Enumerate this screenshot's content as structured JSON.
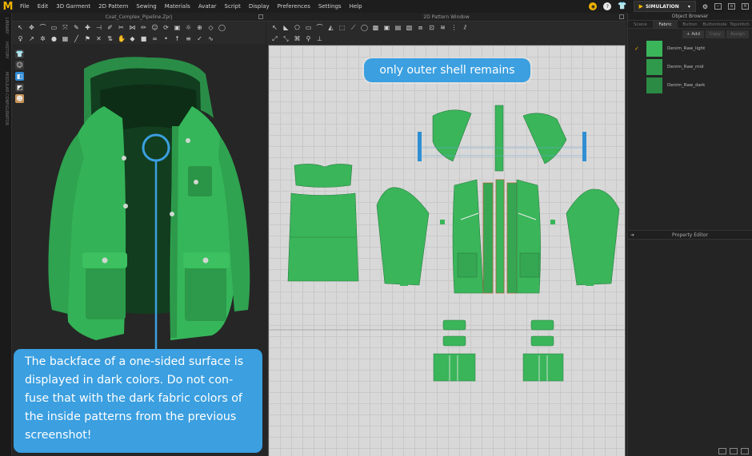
{
  "app": {
    "logo": "M",
    "menu": [
      "File",
      "Edit",
      "3D Garment",
      "2D Pattern",
      "Sewing",
      "Materials",
      "Avatar",
      "Script",
      "Display",
      "Preferences",
      "Settings",
      "Help"
    ],
    "simulation_label": "SIMULATION"
  },
  "left_strip": {
    "labels": [
      "LIBRARY",
      "HISTORY",
      "MODULAR CONFIGURATOR"
    ]
  },
  "window_3d": {
    "title": "Coat_Complex_Pipeline.Zprj"
  },
  "window_2d": {
    "title": "2D Pattern Window"
  },
  "object_browser": {
    "title": "Object Browser",
    "tabs": [
      "Scene",
      "Fabric",
      "Button",
      "Buttonhole",
      "Topstitch"
    ],
    "active_tab": "Fabric",
    "actions": [
      "+ Add",
      "Copy",
      "Assign"
    ],
    "fabrics": [
      {
        "name": "Denim_Raw_light",
        "color": "#3ab55a",
        "selected": true
      },
      {
        "name": "Denim_Raw_mid",
        "color": "#2f9a4b",
        "selected": false
      },
      {
        "name": "Denim_Raw_dark",
        "color": "#2b8a44",
        "selected": false
      }
    ]
  },
  "property_editor": {
    "title": "Property Editor"
  },
  "callouts": {
    "top": "only outer shell remains",
    "bottom": "The backface of a one-sided surface is displayed in dark colors. Do not con-fuse that with the dark fabric colors of the inside patterns from the previous screenshot!"
  },
  "colors": {
    "fabric_green": "#3ab55a",
    "callout_blue": "#3b9fe0",
    "accent_yellow": "#f0b400"
  },
  "icons": [
    "eye-icon",
    "help-icon",
    "tshirt-icon",
    "dropdown-icon",
    "settings-icon"
  ]
}
